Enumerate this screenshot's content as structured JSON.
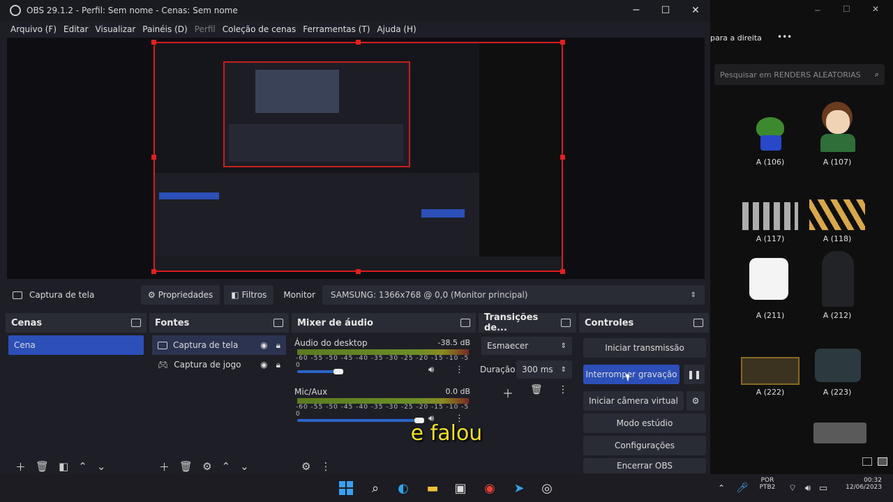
{
  "window": {
    "title": "OBS 29.1.2 - Perfil: Sem nome - Cenas: Sem nome",
    "min": "─",
    "max": "☐",
    "close": "✕"
  },
  "menu": [
    {
      "label": "Arquivo (F)",
      "enabled": true
    },
    {
      "label": "Editar",
      "enabled": true
    },
    {
      "label": "Visualizar",
      "enabled": true
    },
    {
      "label": "Painéis (D)",
      "enabled": true
    },
    {
      "label": "Perfil",
      "enabled": false
    },
    {
      "label": "Coleção de cenas",
      "enabled": true
    },
    {
      "label": "Ferramentas (T)",
      "enabled": true
    },
    {
      "label": "Ajuda (H)",
      "enabled": true
    }
  ],
  "source_bar": {
    "source_name": "Captura de tela",
    "properties": "Propriedades",
    "filters": "Filtros",
    "monitor_label": "Monitor",
    "monitor_value": "SAMSUNG: 1366x768 @ 0,0 (Monitor principal)"
  },
  "scenes": {
    "title": "Cenas",
    "items": [
      "Cena"
    ]
  },
  "sources": {
    "title": "Fontes",
    "items": [
      "Captura de tela",
      "Captura de jogo"
    ]
  },
  "mixer": {
    "title": "Mixer de áudio",
    "channels": [
      {
        "name": "Áudio do desktop",
        "db": "-38.5 dB",
        "level": 0.08
      },
      {
        "name": "Mic/Aux",
        "db": "0.0 dB",
        "level": 0.97
      }
    ],
    "ticks": "-60 -55 -50 -45 -40 -35 -30 -25 -20 -15 -10 -5 0"
  },
  "transitions": {
    "title": "Transições de...",
    "selected": "Esmaecer",
    "duration_label": "Duração",
    "duration_value": "300 ms"
  },
  "controls": {
    "title": "Controles",
    "buttons": [
      "Iniciar transmissão",
      "Interromper gravação",
      "Iniciar câmera virtual",
      "Modo estúdio",
      "Configurações",
      "Encerrar OBS"
    ]
  },
  "explorer": {
    "breadcrumb": "para a direita",
    "more": "•••",
    "search_placeholder": "Pesquisar em RENDERS ALEATORIAS",
    "items": [
      "A (106)",
      "A (107)",
      "A (117)",
      "A (118)",
      "A (211)",
      "A (212)",
      "A (222)",
      "A (223)"
    ]
  },
  "taskbar": {
    "lang_top": "POR",
    "lang_bottom": "PTB2",
    "time": "00:32",
    "date": "12/06/2023"
  },
  "subtitle": "e falou",
  "colors": {
    "accent": "#2c4fb8",
    "recording_border": "#d71d1d",
    "subtitle": "#f2e02a"
  }
}
